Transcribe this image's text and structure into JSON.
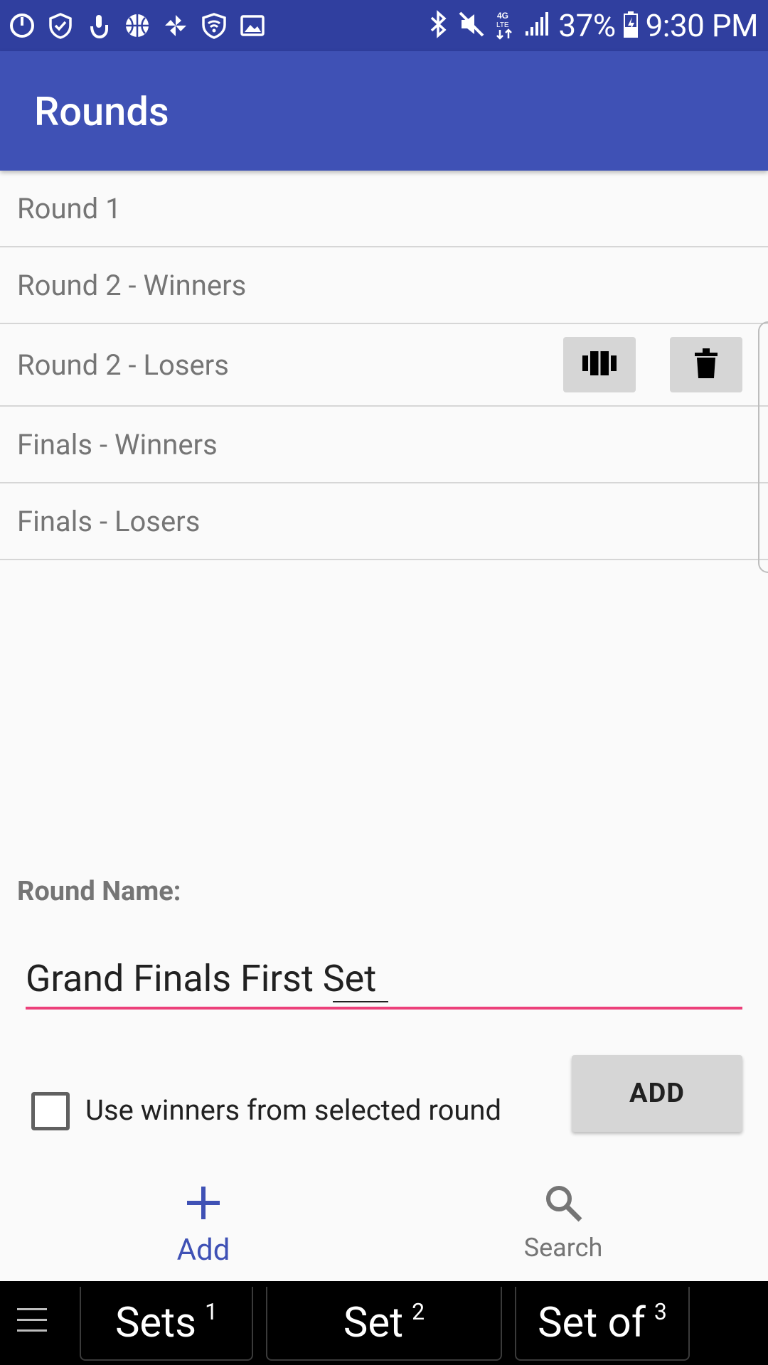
{
  "status_bar": {
    "left_icons": [
      "power-icon",
      "shield-check-icon",
      "touch-icon",
      "basketball-icon",
      "pinwheel-icon",
      "wifi-shield-icon",
      "image-icon"
    ],
    "right_icons": [
      "bluetooth-icon",
      "mute-icon",
      "data-lte-icon",
      "signal-icon"
    ],
    "battery": "37%",
    "time": "9:30 PM"
  },
  "app_bar": {
    "title": "Rounds"
  },
  "rounds": [
    {
      "label": "Round 1"
    },
    {
      "label": "Round 2 - Winners"
    },
    {
      "label": "Round 2 - Losers"
    },
    {
      "label": "Finals - Winners"
    },
    {
      "label": "Finals - Losers"
    }
  ],
  "form": {
    "round_name_label": "Round Name:",
    "round_name_value": "Grand Finals First Set",
    "checkbox_label": "Use winners from selected round",
    "checkbox_checked": false,
    "add_button": "ADD"
  },
  "bottom_nav": {
    "add_label": "Add",
    "search_label": "Search"
  },
  "suggestions": {
    "items": [
      {
        "text": "Sets",
        "index": "1"
      },
      {
        "text": "Set",
        "index": "2"
      },
      {
        "text": "Set of",
        "index": "3"
      }
    ]
  },
  "colors": {
    "status_bar": "#303f9f",
    "app_bar": "#3f51b5",
    "accent": "#ec407a",
    "nav_active": "#3f51b5"
  }
}
